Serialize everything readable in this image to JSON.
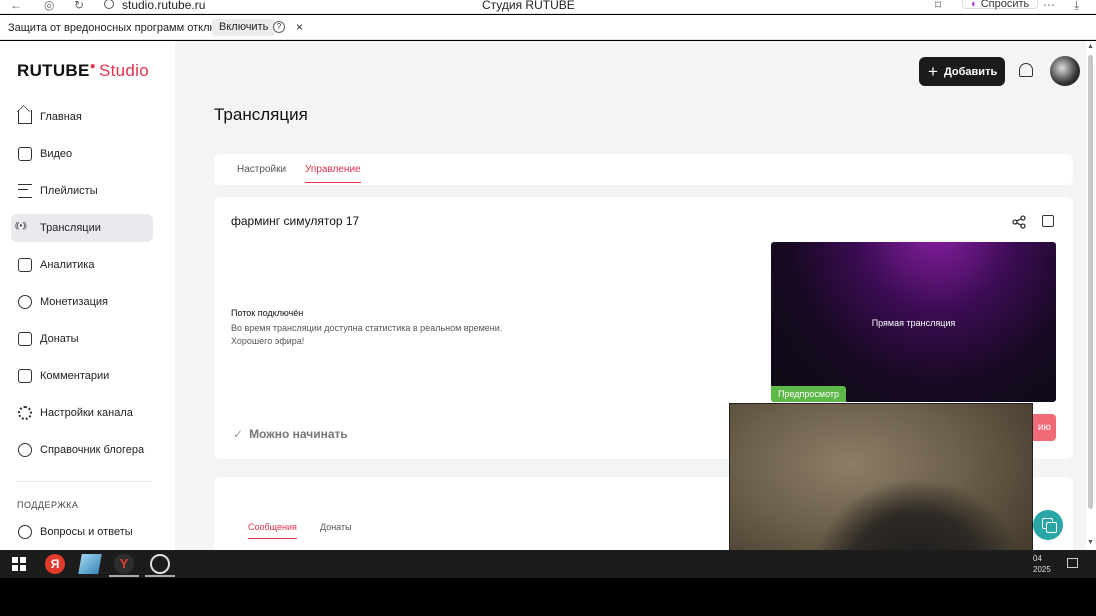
{
  "browser": {
    "url": "studio.rutube.ru",
    "tab_title": "Студия RUTUBE",
    "ask_label": "Спросить"
  },
  "protection_bar": {
    "message": "Защита от вредоносных программ отключена",
    "enable_label": "Включить",
    "help_glyph": "?",
    "close_glyph": "×"
  },
  "logo": {
    "brand": "RUTUBE",
    "product": "Studio"
  },
  "sidebar": {
    "items": [
      {
        "label": "Главная",
        "icon": "home-icon"
      },
      {
        "label": "Видео",
        "icon": "video-icon"
      },
      {
        "label": "Плейлисты",
        "icon": "playlist-icon"
      },
      {
        "label": "Трансляции",
        "icon": "broadcast-icon"
      },
      {
        "label": "Аналитика",
        "icon": "analytics-icon"
      },
      {
        "label": "Монетизация",
        "icon": "ruble-icon"
      },
      {
        "label": "Донаты",
        "icon": "gift-icon"
      },
      {
        "label": "Комментарии",
        "icon": "comment-icon"
      },
      {
        "label": "Настройки канала",
        "icon": "gear-icon"
      },
      {
        "label": "Справочник блогера",
        "icon": "info-icon"
      }
    ],
    "active_index": 3,
    "support_heading": "ПОДДЕРЖКА",
    "faq_label": "Вопросы и ответы"
  },
  "header": {
    "add_label": "Добавить"
  },
  "main": {
    "page_title": "Трансляция",
    "tabs": [
      {
        "label": "Настройки"
      },
      {
        "label": "Управление"
      }
    ],
    "active_tab": 1,
    "stream": {
      "title": "фарминг симулятор 17",
      "status_title": "Поток подключён",
      "status_desc_1": "Во время трансляции доступна статистика в реальном времени.",
      "status_desc_2": "Хорошего эфира!",
      "preview_text": "Прямая трансляция",
      "preview_badge": "Предпросмотр",
      "can_start": "Можно начинать",
      "action_partial": "ию"
    },
    "chat_tabs": [
      {
        "label": "Сообщения"
      },
      {
        "label": "Донаты"
      }
    ]
  },
  "taskbar": {
    "time_partial": "04",
    "date_partial": "2025"
  }
}
